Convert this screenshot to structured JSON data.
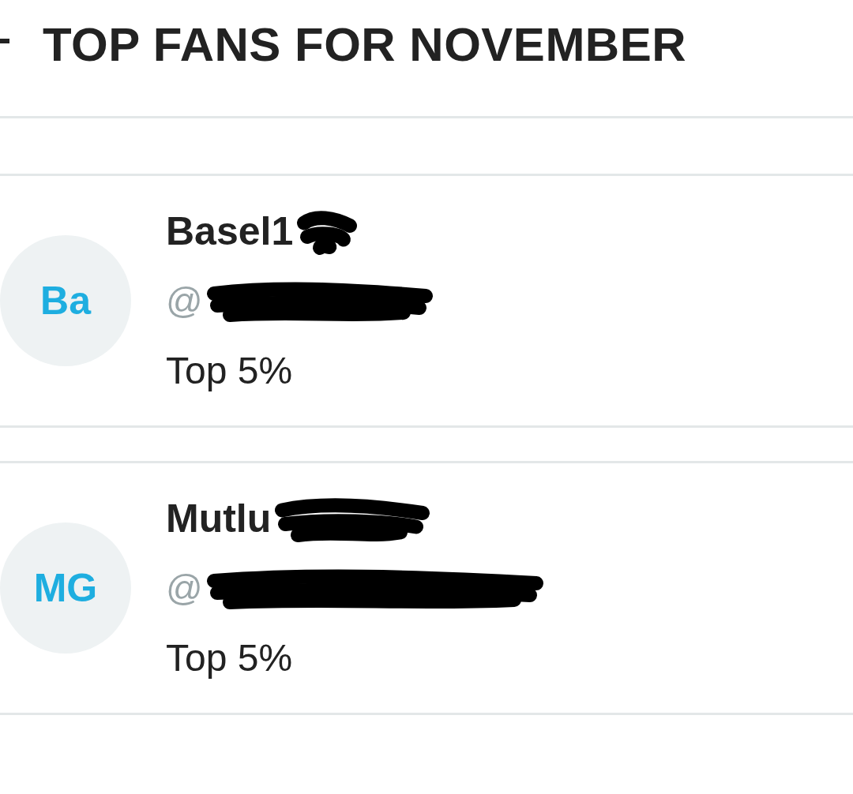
{
  "header": {
    "title": "TOP FANS FOR NOVEMBER"
  },
  "fans": [
    {
      "initials": "Ba",
      "name": "Basel1",
      "handle": "@",
      "rank": "Top 5%"
    },
    {
      "initials": "MG",
      "name": "Mutlu",
      "handle": "@",
      "rank": "Top 5%"
    }
  ]
}
